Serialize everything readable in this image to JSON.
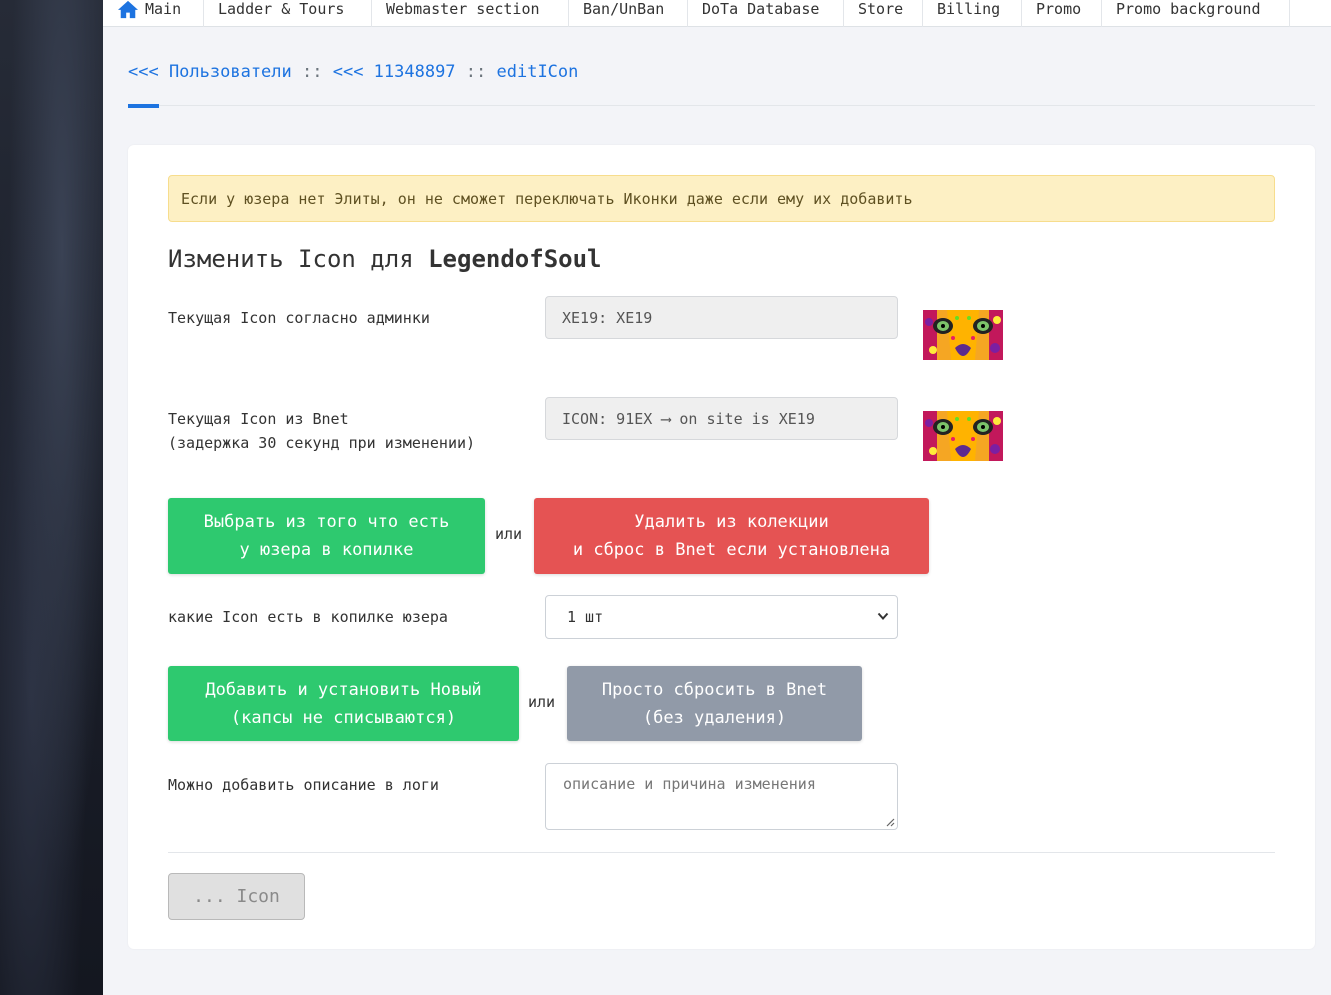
{
  "nav": {
    "items": [
      {
        "label": "Main"
      },
      {
        "label": "Ladder & Tours"
      },
      {
        "label": "Webmaster section"
      },
      {
        "label": "Ban/UnBan"
      },
      {
        "label": "DoTa Database"
      },
      {
        "label": "Store"
      },
      {
        "label": "Billing"
      },
      {
        "label": "Promo"
      },
      {
        "label": "Promo background"
      }
    ]
  },
  "breadcrumb": {
    "users_link": "<<< Пользователи",
    "sep1": " :: ",
    "user_link": "<<< 11348897",
    "sep2": " :: ",
    "current": "editICon"
  },
  "alert": {
    "text": "Если у юзера нет Элиты, он не сможет переключать Иконки даже если ему их добавить"
  },
  "heading": {
    "prefix": "Изменить Icon для ",
    "username": "LegendofSoul"
  },
  "current_admin": {
    "label": "Текущая Icon согласно админки",
    "value": "XE19: XE19"
  },
  "current_bnet": {
    "label": "Текущая Icon из Bnet\n(задержка 30 секунд при изменении)",
    "value": "ICON: 91EX ⟶ on site is XE19"
  },
  "actions_row1": {
    "select_label": "Выбрать из того что есть\nу юзера в копилке",
    "or": "или",
    "delete_label": "Удалить из колекции\nи сброс в Bnet если установлена"
  },
  "collection": {
    "label": "какие Icon есть в копилке юзера",
    "selected": "1 шт"
  },
  "actions_row2": {
    "add_label": "Добавить и установить Новый\n(капсы не списываются)",
    "or": "или",
    "reset_label": "Просто сбросить в Bnet\n(без удаления)"
  },
  "log": {
    "label": "Можно добавить описание в логи",
    "placeholder": "описание и причина изменения"
  },
  "submit": {
    "label": "... Icon"
  },
  "colors": {
    "link": "#1d73e0",
    "green": "#2ec96f",
    "red": "#e55353",
    "gray": "#919aa8",
    "alert_bg": "#fdf0c4"
  }
}
